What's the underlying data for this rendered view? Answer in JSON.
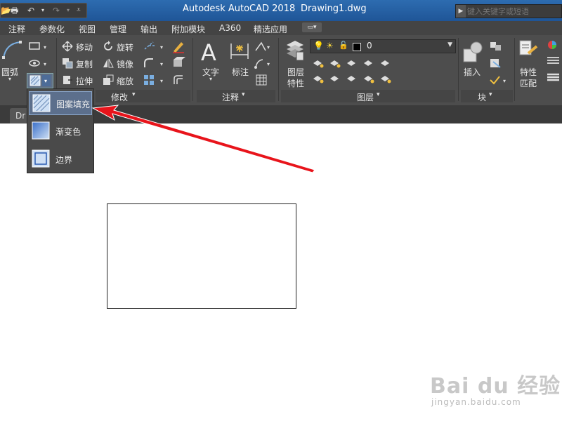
{
  "titlebar": {
    "app_title": "Autodesk AutoCAD 2018",
    "doc_title": "Drawing1.dwg",
    "search_placeholder": "键入关键字或短语",
    "accent": "#2d6cb0"
  },
  "menu": [
    "注释",
    "参数化",
    "视图",
    "管理",
    "输出",
    "附加模块",
    "A360",
    "精选应用"
  ],
  "ribbon": {
    "draw": {
      "arc_label": "圆弧"
    },
    "modify": {
      "move": "移动",
      "rotate": "旋转",
      "copy": "复制",
      "mirror": "镜像",
      "stretch": "拉伸",
      "scale": "缩放",
      "panel": "修改"
    },
    "annotation": {
      "text": "文字",
      "dim": "标注",
      "panel": "注释"
    },
    "layers": {
      "props_line1": "图层",
      "props_line2": "特性",
      "current": "0",
      "panel": "图层"
    },
    "block": {
      "insert": "插入",
      "panel": "块"
    },
    "properties": {
      "line1": "特性",
      "line2": "匹配"
    }
  },
  "tab": {
    "label": "Dr"
  },
  "dropdown": {
    "items": [
      {
        "label": "图案填充"
      },
      {
        "label": "渐变色"
      },
      {
        "label": "边界"
      }
    ]
  },
  "watermark": {
    "logo": "Bai du 经验",
    "url": "jingyan.baidu.com"
  },
  "colors": {
    "annotation_arrow": "#e8141b",
    "ribbon_bg": "#4d4d4d"
  }
}
